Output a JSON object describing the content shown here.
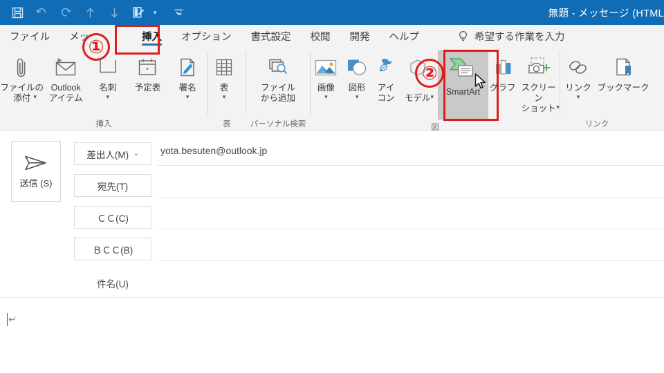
{
  "window": {
    "title": "無題  -  メッセージ (HTML",
    "accent_color": "#106CB4"
  },
  "quick_access": {
    "items": [
      {
        "name": "save-icon",
        "tooltip": "上書き保存"
      },
      {
        "name": "undo-icon",
        "tooltip": "元に戻す"
      },
      {
        "name": "redo-icon",
        "tooltip": "やり直し"
      },
      {
        "name": "previous-item-icon",
        "tooltip": "前のアイテム"
      },
      {
        "name": "next-item-icon",
        "tooltip": "次のアイテム"
      },
      {
        "name": "touch-mouse-mode-icon",
        "tooltip": "タッチ/マウス モードの切り替え"
      },
      {
        "name": "customize-qat-icon",
        "tooltip": "クイック アクセス ツール バーのユーザー設定"
      }
    ]
  },
  "tabs": {
    "items": [
      {
        "label": "ファイル",
        "active": false
      },
      {
        "label": "メッ",
        "active": false
      },
      {
        "label": "挿入",
        "active": true
      },
      {
        "label": "オプション",
        "active": false
      },
      {
        "label": "書式設定",
        "active": false
      },
      {
        "label": "校閲",
        "active": false
      },
      {
        "label": "開発",
        "active": false
      },
      {
        "label": "ヘルプ",
        "active": false
      }
    ],
    "tell_me": "希望する作業を入力"
  },
  "ribbon": {
    "groups": [
      {
        "label": "挿入",
        "buttons": [
          {
            "label": "ファイルの\n添付",
            "icon": "paperclip-icon",
            "dropdown": true,
            "inline_caret": true
          },
          {
            "label": "Outlook\nアイテム",
            "icon": "envelope-icon",
            "dropdown": false
          },
          {
            "label": "名刺",
            "icon": "business-card-icon",
            "dropdown": true
          },
          {
            "label": "予定表",
            "icon": "calendar-icon",
            "dropdown": false
          },
          {
            "label": "署名",
            "icon": "signature-icon",
            "dropdown": true
          }
        ]
      },
      {
        "label": "表",
        "buttons": [
          {
            "label": "表",
            "icon": "table-icon",
            "dropdown": true
          }
        ]
      },
      {
        "label": "パーソナル検索",
        "buttons": [
          {
            "label": "ファイル\nから追加",
            "icon": "file-search-icon",
            "dropdown": false
          }
        ]
      },
      {
        "label": "図",
        "buttons": [
          {
            "label": "画像",
            "icon": "picture-icon",
            "dropdown": true
          },
          {
            "label": "図形",
            "icon": "shapes-icon",
            "dropdown": true
          },
          {
            "label": "アイ\nコン",
            "icon": "icons-icon",
            "dropdown": false
          },
          {
            "label": "モデル",
            "icon": "3d-model-icon",
            "dropdown": true,
            "inline_caret": true
          },
          {
            "label": "SmartArt",
            "icon": "smartart-icon",
            "dropdown": false,
            "selected": true
          },
          {
            "label": "グラフ",
            "icon": "chart-icon",
            "dropdown": false
          },
          {
            "label": "スクリーン\nショット",
            "icon": "screenshot-icon",
            "dropdown": true,
            "inline_caret": true
          }
        ]
      },
      {
        "label": "リンク",
        "buttons": [
          {
            "label": "リンク",
            "icon": "link-icon",
            "dropdown": true
          },
          {
            "label": "ブックマーク",
            "icon": "bookmark-icon",
            "dropdown": false
          }
        ]
      }
    ]
  },
  "compose": {
    "send_button": {
      "label": "送信\n(S)",
      "icon": "send-arrow-icon"
    },
    "fields": [
      {
        "name": "from",
        "label": "差出人(M)",
        "type": "dropdown-button",
        "value": "yota.besuten@outlook.jp"
      },
      {
        "name": "to",
        "label": "宛先(T)",
        "type": "button",
        "value": ""
      },
      {
        "name": "cc",
        "label": "ＣＣ(C)",
        "type": "button",
        "value": ""
      },
      {
        "name": "bcc",
        "label": "ＢＣＣ(B)",
        "type": "button",
        "value": ""
      },
      {
        "name": "subject",
        "label": "件名(U)",
        "type": "label",
        "value": ""
      }
    ],
    "body": {
      "value": "",
      "paragraph_mark": "↵"
    }
  },
  "annotations": [
    {
      "name": "step-1-marker",
      "label": "①",
      "target": "insert-tab"
    },
    {
      "name": "step-2-marker",
      "label": "②",
      "target": "smartart-button"
    }
  ]
}
